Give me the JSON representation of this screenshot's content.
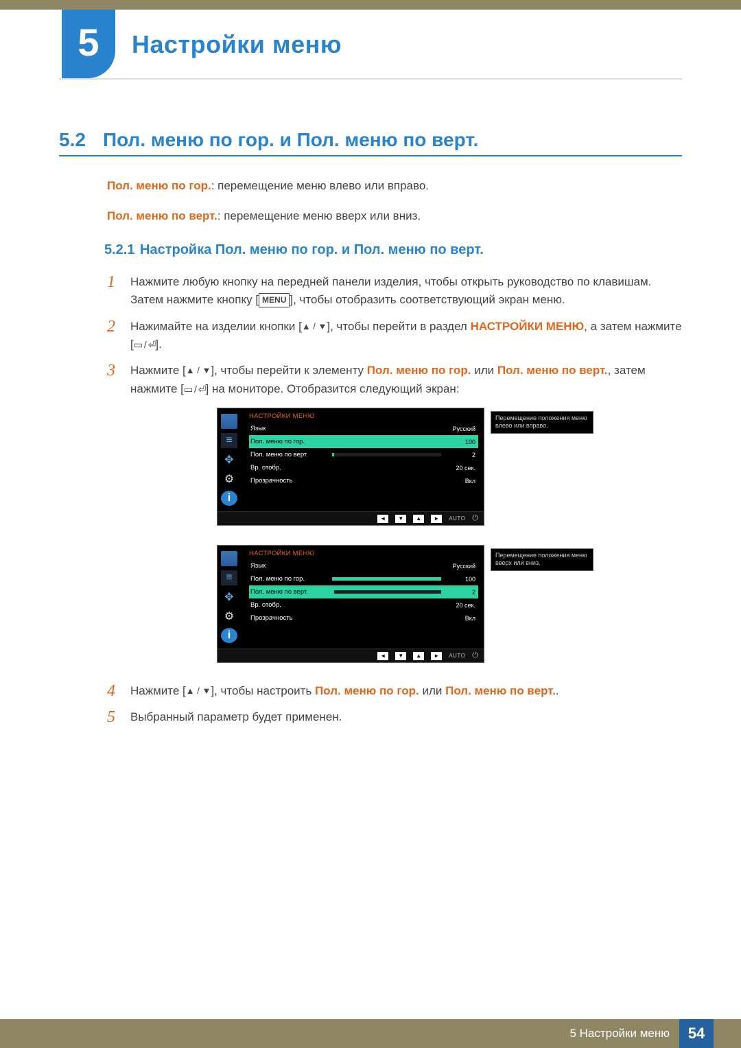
{
  "header": {
    "chapter_num": "5",
    "chapter_title": "Настройки меню"
  },
  "section": {
    "number": "5.2",
    "title": "Пол. меню по гор. и Пол. меню по верт."
  },
  "intro": {
    "line1_label": "Пол. меню по гор.",
    "line1_text": ": перемещение меню влево или вправо.",
    "line2_label": "Пол. меню по верт.",
    "line2_text": ": перемещение меню вверх или вниз."
  },
  "subsection": {
    "number": "5.2.1",
    "title": "Настройка Пол. меню по гор. и Пол. меню по верт."
  },
  "steps": {
    "s1_num": "1",
    "s1_text_a": "Нажмите любую кнопку на передней панели изделия, чтобы открыть руководство по клавишам. Затем нажмите кнопку [",
    "s1_menu": "MENU",
    "s1_text_b": "], чтобы отобразить соответствующий экран меню.",
    "s2_num": "2",
    "s2_text_a": "Нажимайте на изделии кнопки [",
    "s2_tri": "▲ / ▼",
    "s2_text_b": "], чтобы перейти в раздел ",
    "s2_bold": "НАСТРОЙКИ МЕНЮ",
    "s2_text_c": ", а затем нажмите [",
    "s2_box": "▭ / ⏎",
    "s2_text_d": "].",
    "s3_num": "3",
    "s3_text_a": "Нажмите [",
    "s3_tri": "▲ / ▼",
    "s3_text_b": "], чтобы перейти к элементу ",
    "s3_bold1": "Пол. меню по гор.",
    "s3_or": " или ",
    "s3_bold2": "Пол. меню по верт.",
    "s3_text_c": ", затем нажмите [",
    "s3_box": "▭ / ⏎",
    "s3_text_d": "] на мониторе. Отобразится следующий экран:",
    "s4_num": "4",
    "s4_text_a": "Нажмите [",
    "s4_tri": "▲ / ▼",
    "s4_text_b": "], чтобы настроить ",
    "s4_bold1": "Пол. меню по гор.",
    "s4_or": " или ",
    "s4_bold2": "Пол. меню по верт.",
    "s5_num": "5",
    "s5_text": "Выбранный параметр будет применен."
  },
  "osd1": {
    "title": "НАСТРОЙКИ МЕНЮ",
    "rows": [
      {
        "lbl": "Язык",
        "val": "Русский",
        "bar": null
      },
      {
        "lbl": "Пол. меню по гор.",
        "val": "100",
        "bar": 100,
        "selected": true
      },
      {
        "lbl": "Пол. меню по верт.",
        "val": "2",
        "bar": 2
      },
      {
        "lbl": "Вр. отобр.",
        "val": "20 сек.",
        "bar": null
      },
      {
        "lbl": "Прозрачность",
        "val": "Вкл",
        "bar": null
      }
    ],
    "tip": "Перемещение положения меню влево или вправо.",
    "nav_auto": "AUTO"
  },
  "osd2": {
    "title": "НАСТРОЙКИ МЕНЮ",
    "rows": [
      {
        "lbl": "Язык",
        "val": "Русский",
        "bar": null
      },
      {
        "lbl": "Пол. меню по гор.",
        "val": "100",
        "bar": 100
      },
      {
        "lbl": "Пол. меню по верт.",
        "val": "2",
        "bar": 2,
        "selected": true
      },
      {
        "lbl": "Вр. отобр.",
        "val": "20 сек.",
        "bar": null
      },
      {
        "lbl": "Прозрачность",
        "val": "Вкл",
        "bar": null
      }
    ],
    "tip": "Перемещение положения меню вверх или вниз.",
    "nav_auto": "AUTO"
  },
  "footer": {
    "label": "5 Настройки меню",
    "page": "54"
  }
}
